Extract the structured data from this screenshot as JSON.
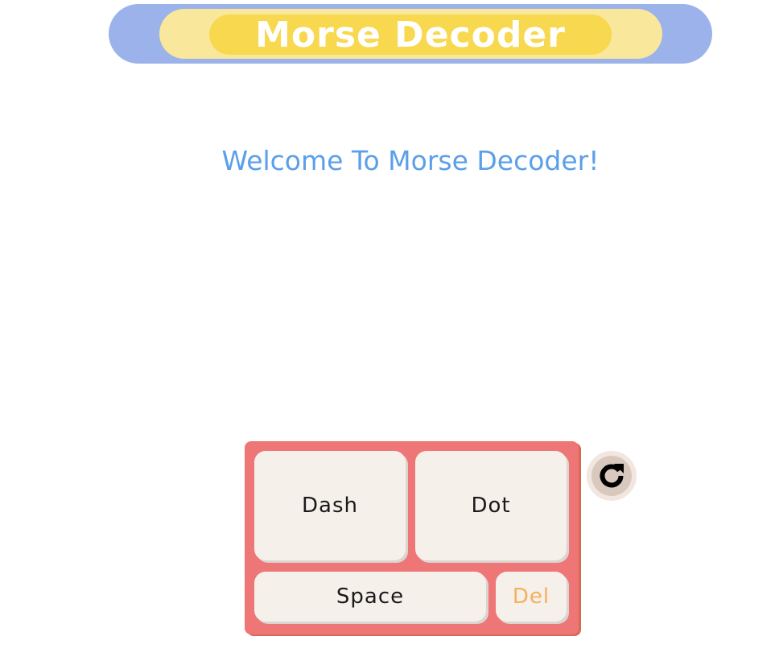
{
  "header": {
    "title": "Morse Decoder"
  },
  "main": {
    "welcome_text": "Welcome To Morse Decoder!"
  },
  "keypad": {
    "dash_label": "Dash",
    "dot_label": "Dot",
    "space_label": "Space",
    "delete_label": "Del"
  },
  "controls": {
    "reset_icon": "reload-icon"
  },
  "colors": {
    "header_outer": "#9bb2ea",
    "header_mid": "#f9e89c",
    "header_inner": "#f8d84f",
    "welcome_text": "#5b9fe9",
    "keypad_bg": "#ef7676",
    "key_bg": "#f5f0ea",
    "delete_text": "#f5b05e"
  }
}
